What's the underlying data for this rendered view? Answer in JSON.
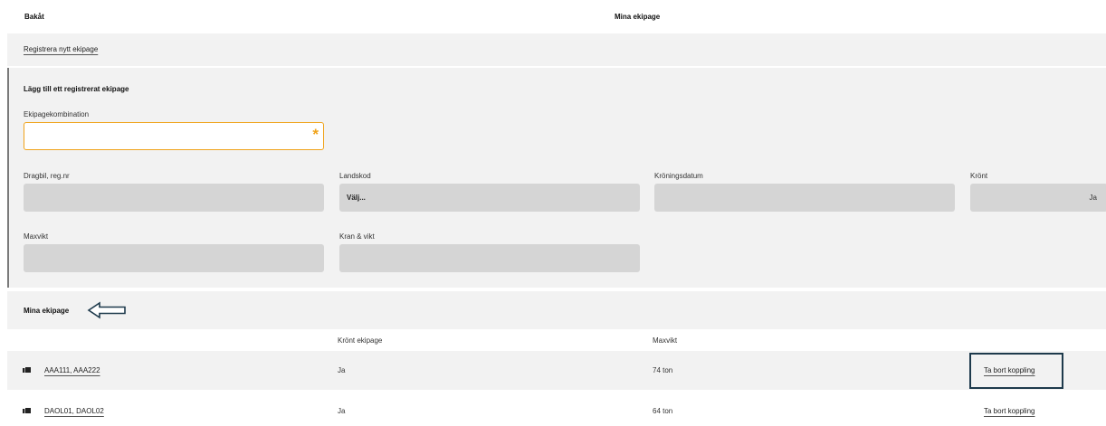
{
  "header": {
    "back_label": "Bakåt",
    "title": "Mina ekipage"
  },
  "register": {
    "link_label": "Registrera nytt ekipage"
  },
  "form": {
    "heading": "Lägg till ett registrerat ekipage",
    "combination_label": "Ekipagekombination",
    "combination_value": "",
    "required_marker": "*",
    "tractor_label": "Dragbil, reg.nr",
    "country_label": "Landskod",
    "country_value": "Välj...",
    "crowning_date_label": "Kröningsdatum",
    "crowned_label": "Krönt",
    "crowned_value": "Ja",
    "maxweight_label": "Maxvikt",
    "crane_label": "Kran & vikt"
  },
  "list": {
    "title": "Mina ekipage",
    "columns": [
      "Krönt ekipage",
      "Maxvikt"
    ],
    "rows": [
      {
        "combination": "AAA111, AAA222",
        "crowned": "Ja",
        "maxweight": "74 ton",
        "action": "Ta bort koppling"
      },
      {
        "combination": "DAOL01, DAOL02",
        "crowned": "Ja",
        "maxweight": "64 ton",
        "action": "Ta bort koppling"
      }
    ]
  },
  "colors": {
    "required_accent": "#f0a31a",
    "panel_bg": "#f2f2f2",
    "input_gray": "#d5d5d5",
    "focus_border": "#1e3a4c"
  }
}
